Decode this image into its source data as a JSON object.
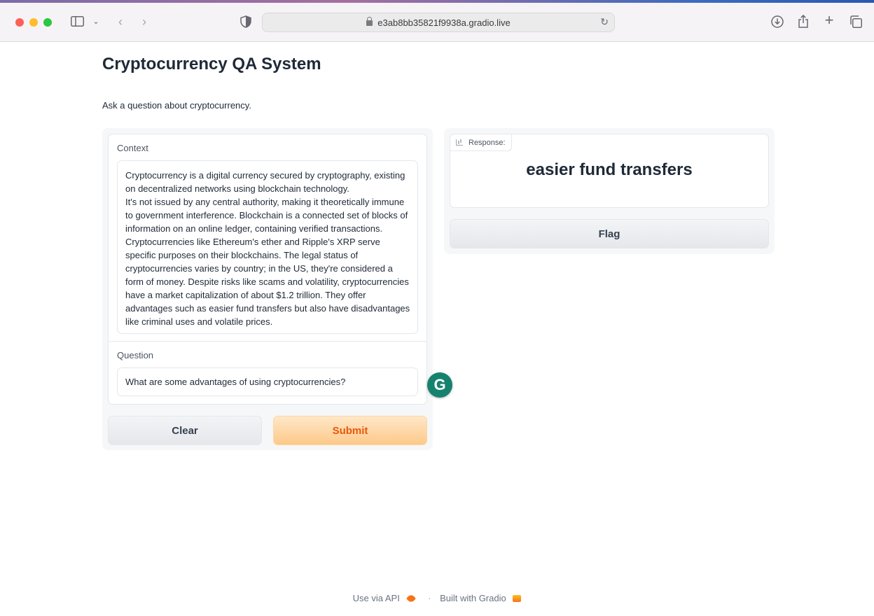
{
  "browser": {
    "url": "e3ab8bb35821f9938a.gradio.live"
  },
  "page": {
    "title": "Cryptocurrency QA System",
    "description": "Ask a question about cryptocurrency."
  },
  "inputs": {
    "context_label": "Context",
    "context_value": "Cryptocurrency is a digital currency secured by cryptography, existing on decentralized networks using blockchain technology.\nIt's not issued by any central authority, making it theoretically immune to government interference. Blockchain is a connected set of blocks of information on an online ledger, containing verified transactions. Cryptocurrencies like Ethereum's ether and Ripple's XRP serve specific purposes on their blockchains. The legal status of cryptocurrencies varies by country; in the US, they're considered a form of money. Despite risks like scams and volatility, cryptocurrencies have a market capitalization of about $1.2 trillion. They offer advantages such as easier fund transfers but also have disadvantages like criminal uses and volatile prices.",
    "question_label": "Question",
    "question_value": "What are some advantages of using cryptocurrencies?"
  },
  "buttons": {
    "clear": "Clear",
    "submit": "Submit",
    "flag": "Flag"
  },
  "output": {
    "label": "Response:",
    "value": "easier fund transfers"
  },
  "extension": {
    "grammarly_letter": "G"
  },
  "footer": {
    "api_link": "Use via API",
    "separator": "·",
    "built_with": "Built with Gradio"
  },
  "colors": {
    "accent": "#ea580c",
    "submit_bg": "#fdc98a",
    "grammarly": "#15826e"
  }
}
